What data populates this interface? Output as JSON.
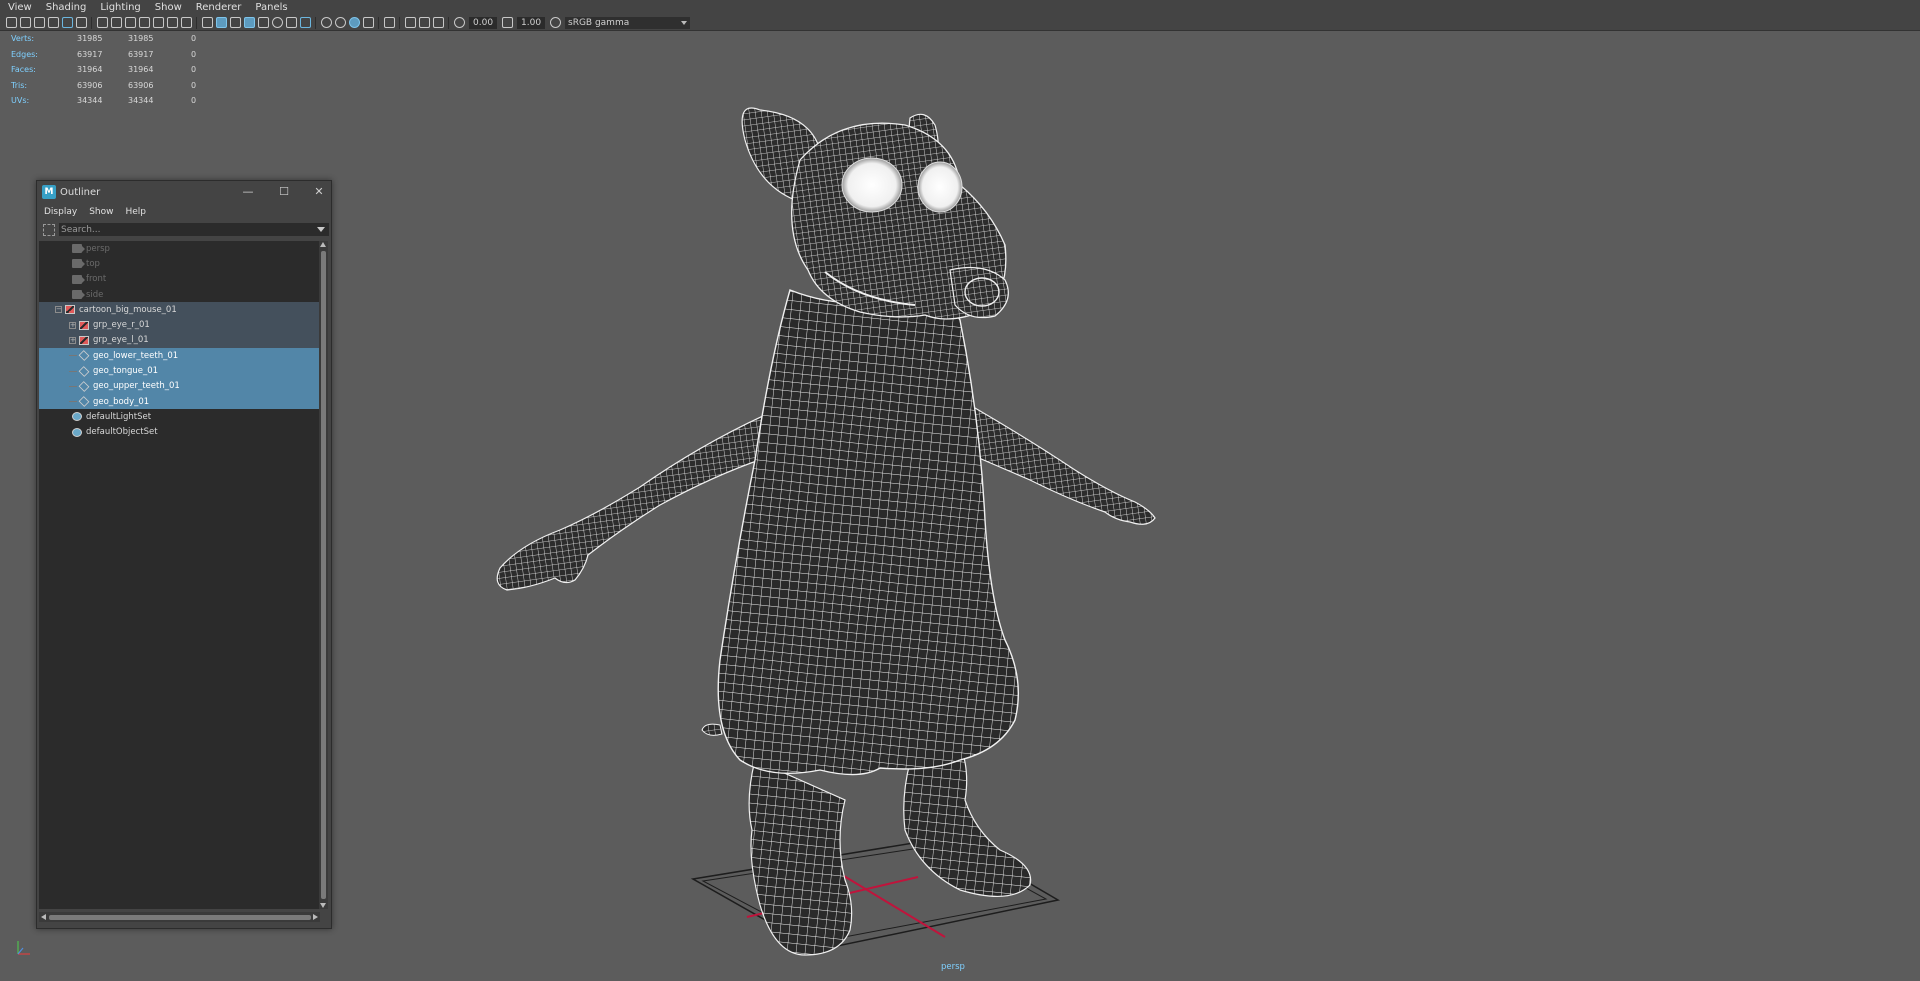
{
  "menubar": {
    "items": [
      "View",
      "Shading",
      "Lighting",
      "Show",
      "Renderer",
      "Panels"
    ]
  },
  "toolbar": {
    "exposure": "0.00",
    "gamma": "1.00",
    "color_space": "sRGB gamma"
  },
  "hud": {
    "rows": [
      {
        "label": "Verts:",
        "v1": "31985",
        "v2": "31985",
        "v3": "0"
      },
      {
        "label": "Edges:",
        "v1": "63917",
        "v2": "63917",
        "v3": "0"
      },
      {
        "label": "Faces:",
        "v1": "31964",
        "v2": "31964",
        "v3": "0"
      },
      {
        "label": "Tris:",
        "v1": "63906",
        "v2": "63906",
        "v3": "0"
      },
      {
        "label": "UVs:",
        "v1": "34344",
        "v2": "34344",
        "v3": "0"
      }
    ]
  },
  "outliner": {
    "title": "Outliner",
    "menus": [
      "Display",
      "Show",
      "Help"
    ],
    "search_placeholder": "Search...",
    "items": [
      {
        "label": "persp",
        "icon": "camera-icon",
        "indent": 1,
        "state": "dim"
      },
      {
        "label": "top",
        "icon": "camera-icon",
        "indent": 1,
        "state": "dim"
      },
      {
        "label": "front",
        "icon": "camera-icon",
        "indent": 1,
        "state": "dim"
      },
      {
        "label": "side",
        "icon": "camera-icon",
        "indent": 1,
        "state": "dim"
      },
      {
        "label": "cartoon_big_mouse_01",
        "icon": "transform-icon",
        "indent": 0,
        "expander": "−",
        "state": "sel-parent"
      },
      {
        "label": "grp_eye_r_01",
        "icon": "transform-icon",
        "indent": 2,
        "expander": "+",
        "state": "sel-parent"
      },
      {
        "label": "grp_eye_l_01",
        "icon": "transform-icon",
        "indent": 2,
        "expander": "+",
        "state": "sel-parent"
      },
      {
        "label": "geo_lower_teeth_01",
        "icon": "mesh-icon",
        "indent": 2,
        "dash": true,
        "state": "sel"
      },
      {
        "label": "geo_tongue_01",
        "icon": "mesh-icon",
        "indent": 2,
        "dash": true,
        "state": "sel"
      },
      {
        "label": "geo_upper_teeth_01",
        "icon": "mesh-icon",
        "indent": 2,
        "dash": true,
        "state": "sel"
      },
      {
        "label": "geo_body_01",
        "icon": "mesh-icon",
        "indent": 2,
        "dash": true,
        "state": "sel"
      },
      {
        "label": "defaultLightSet",
        "icon": "set-icon",
        "indent": 1,
        "state": "normal"
      },
      {
        "label": "defaultObjectSet",
        "icon": "set-icon",
        "indent": 1,
        "state": "normal"
      }
    ]
  },
  "viewport": {
    "camera": "persp",
    "accent_color": "#7fd0ff",
    "wire_color": "#ffffff",
    "selection_color": "#5286a8",
    "grid_axis_color": "#c0143c"
  }
}
